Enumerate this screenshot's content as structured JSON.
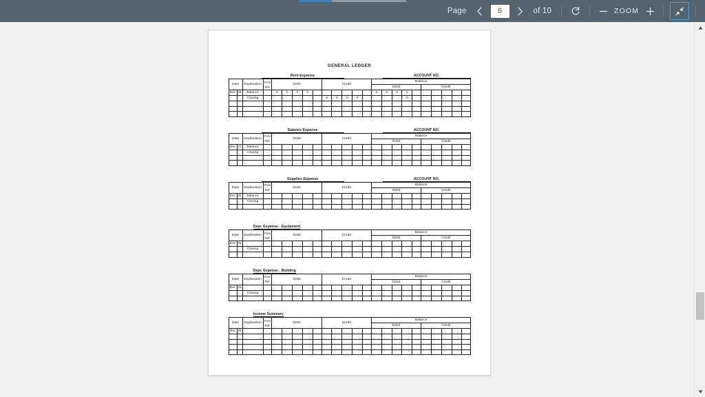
{
  "toolbar": {
    "page_label": "Page",
    "prev_icon": "chevron-left-icon",
    "next_icon": "chevron-right-icon",
    "page_value": "6",
    "of_label": "of 10",
    "rotate_icon": "rotate-icon",
    "zoom_out_icon": "minus-icon",
    "zoom_label": "ZOOM",
    "zoom_in_icon": "plus-icon",
    "fullscreen_exit_icon": "fullscreen-exit-icon",
    "bg_color": "#54646f",
    "accent_color": "#4a9fe0"
  },
  "progress": {
    "fill_color": "#3f7fb3",
    "track_color": "#8e9ba5"
  },
  "scrollbar": {
    "up_icon": "triangle-up-icon",
    "down_icon": "triangle-down-icon",
    "thumb_color": "#c1c1c1"
  },
  "document": {
    "title": "GENERAL LEDGER",
    "account_no_label": "ACCOUNT NO.",
    "headers": {
      "date": "Date",
      "explanation": "Explanation",
      "post": "Post",
      "ref": "Ref.",
      "debit": "Debit",
      "credit": "Credit",
      "balance": "Balance"
    },
    "ledgers": [
      {
        "name": "Rent Expense",
        "name_underline": true,
        "show_account_no": true,
        "title_align": "center",
        "rows": [
          {
            "month": "Dec",
            "day": "31",
            "explanation": "Balance",
            "debit": [
              "6",
              "0",
              "0",
              "0"
            ],
            "credit": [
              "",
              "",
              "",
              ""
            ],
            "bal_debit": [
              "6",
              "0",
              "0",
              "0"
            ],
            "bal_credit": [
              "",
              "",
              "",
              ""
            ]
          },
          {
            "month": "",
            "day": "",
            "explanation": "Closing",
            "debit": [
              "",
              "",
              "",
              ""
            ],
            "credit": [
              "6",
              "0",
              "0",
              "0"
            ],
            "bal_debit": [
              "",
              "",
              "",
              "0"
            ],
            "bal_credit": [
              "",
              "",
              "",
              ""
            ]
          },
          {
            "month": "",
            "day": "",
            "explanation": "",
            "debit": [
              "",
              "",
              "",
              ""
            ],
            "credit": [
              "",
              "",
              "",
              ""
            ],
            "bal_debit": [
              "",
              "",
              "",
              ""
            ],
            "bal_credit": [
              "",
              "",
              "",
              ""
            ]
          },
          {
            "month": "",
            "day": "",
            "explanation": "",
            "debit": [
              "",
              "",
              "",
              ""
            ],
            "credit": [
              "",
              "",
              "",
              ""
            ],
            "bal_debit": [
              "",
              "",
              "",
              ""
            ],
            "bal_credit": [
              "",
              "",
              "",
              ""
            ]
          },
          {
            "month": "",
            "day": "",
            "explanation": "",
            "debit": [
              "",
              "",
              "",
              ""
            ],
            "credit": [
              "",
              "",
              "",
              ""
            ],
            "bal_debit": [
              "",
              "",
              "",
              ""
            ],
            "bal_credit": [
              "",
              "",
              "",
              ""
            ]
          }
        ]
      },
      {
        "name": "Salaries Expense",
        "name_underline": true,
        "show_account_no": true,
        "title_align": "center",
        "rows": [
          {
            "month": "Dec",
            "day": "31",
            "explanation": "Balance",
            "debit": [
              "",
              "",
              "",
              ""
            ],
            "credit": [
              "",
              "",
              "",
              ""
            ],
            "bal_debit": [
              "",
              "",
              "",
              ""
            ],
            "bal_credit": [
              "",
              "",
              "",
              ""
            ]
          },
          {
            "month": "",
            "day": "",
            "explanation": "Closing",
            "debit": [
              "",
              "",
              "",
              ""
            ],
            "credit": [
              "",
              "",
              "",
              ""
            ],
            "bal_debit": [
              "",
              "",
              "",
              ""
            ],
            "bal_credit": [
              "",
              "",
              "",
              ""
            ]
          },
          {
            "month": "",
            "day": "",
            "explanation": "",
            "debit": [
              "",
              "",
              "",
              ""
            ],
            "credit": [
              "",
              "",
              "",
              ""
            ],
            "bal_debit": [
              "",
              "",
              "",
              ""
            ],
            "bal_credit": [
              "",
              "",
              "",
              ""
            ]
          },
          {
            "month": "",
            "day": "",
            "explanation": "",
            "debit": [
              "",
              "",
              "",
              ""
            ],
            "credit": [
              "",
              "",
              "",
              ""
            ],
            "bal_debit": [
              "",
              "",
              "",
              ""
            ],
            "bal_credit": [
              "",
              "",
              "",
              ""
            ]
          }
        ]
      },
      {
        "name": "Supplies Expense",
        "name_underline": true,
        "show_account_no": true,
        "title_align": "center",
        "rows": [
          {
            "month": "Dec",
            "day": "31",
            "explanation": "Balance",
            "debit": [
              "",
              "",
              "",
              ""
            ],
            "credit": [
              "",
              "",
              "",
              ""
            ],
            "bal_debit": [
              "",
              "",
              "",
              ""
            ],
            "bal_credit": [
              "",
              "",
              "",
              ""
            ]
          },
          {
            "month": "",
            "day": "",
            "explanation": "Closing",
            "debit": [
              "",
              "",
              "",
              ""
            ],
            "credit": [
              "",
              "",
              "",
              ""
            ],
            "bal_debit": [
              "",
              "",
              "",
              ""
            ],
            "bal_credit": [
              "",
              "",
              "",
              ""
            ]
          },
          {
            "month": "",
            "day": "",
            "explanation": "",
            "debit": [
              "",
              "",
              "",
              ""
            ],
            "credit": [
              "",
              "",
              "",
              ""
            ],
            "bal_debit": [
              "",
              "",
              "",
              ""
            ],
            "bal_credit": [
              "",
              "",
              "",
              ""
            ]
          }
        ]
      },
      {
        "name": "Depr. Expense - Equipment",
        "name_underline": true,
        "show_account_no": false,
        "title_align": "left",
        "rows": [
          {
            "month": "Dec",
            "day": "31",
            "explanation": "",
            "debit": [
              "",
              "",
              "",
              ""
            ],
            "credit": [
              "",
              "",
              "",
              ""
            ],
            "bal_debit": [
              "",
              "",
              "",
              ""
            ],
            "bal_credit": [
              "",
              "",
              "",
              ""
            ]
          },
          {
            "month": "",
            "day": "",
            "explanation": "Closing",
            "debit": [
              "",
              "",
              "",
              ""
            ],
            "credit": [
              "",
              "",
              "",
              ""
            ],
            "bal_debit": [
              "",
              "",
              "",
              ""
            ],
            "bal_credit": [
              "",
              "",
              "",
              ""
            ]
          },
          {
            "month": "",
            "day": "",
            "explanation": "",
            "debit": [
              "",
              "",
              "",
              ""
            ],
            "credit": [
              "",
              "",
              "",
              ""
            ],
            "bal_debit": [
              "",
              "",
              "",
              ""
            ],
            "bal_credit": [
              "",
              "",
              "",
              ""
            ]
          }
        ]
      },
      {
        "name": "Depr. Expense - Building",
        "name_underline": true,
        "show_account_no": false,
        "title_align": "left",
        "rows": [
          {
            "month": "Dec",
            "day": "31",
            "explanation": "",
            "debit": [
              "",
              "",
              "",
              ""
            ],
            "credit": [
              "",
              "",
              "",
              ""
            ],
            "bal_debit": [
              "",
              "",
              "",
              ""
            ],
            "bal_credit": [
              "",
              "",
              "",
              ""
            ]
          },
          {
            "month": "",
            "day": "",
            "explanation": "Closing",
            "debit": [
              "",
              "",
              "",
              ""
            ],
            "credit": [
              "",
              "",
              "",
              ""
            ],
            "bal_debit": [
              "",
              "",
              "",
              ""
            ],
            "bal_credit": [
              "",
              "",
              "",
              ""
            ]
          },
          {
            "month": "",
            "day": "",
            "explanation": "",
            "debit": [
              "",
              "",
              "",
              ""
            ],
            "credit": [
              "",
              "",
              "",
              ""
            ],
            "bal_debit": [
              "",
              "",
              "",
              ""
            ],
            "bal_credit": [
              "",
              "",
              "",
              ""
            ]
          }
        ]
      },
      {
        "name": "Income Summary",
        "name_underline": true,
        "show_account_no": false,
        "title_align": "left",
        "rows": [
          {
            "month": "Dec",
            "day": "31",
            "explanation": "",
            "debit": [
              "",
              "",
              "",
              ""
            ],
            "credit": [
              "",
              "",
              "",
              ""
            ],
            "bal_debit": [
              "",
              "",
              "",
              ""
            ],
            "bal_credit": [
              "",
              "",
              "",
              ""
            ]
          },
          {
            "month": "",
            "day": "",
            "explanation": "",
            "debit": [
              "",
              "",
              "",
              ""
            ],
            "credit": [
              "",
              "",
              "",
              ""
            ],
            "bal_debit": [
              "",
              "",
              "",
              ""
            ],
            "bal_credit": [
              "",
              "",
              "",
              ""
            ]
          },
          {
            "month": "",
            "day": "",
            "explanation": "",
            "debit": [
              "",
              "",
              "",
              ""
            ],
            "credit": [
              "",
              "",
              "",
              ""
            ],
            "bal_debit": [
              "",
              "",
              "",
              ""
            ],
            "bal_credit": [
              "",
              "",
              "",
              ""
            ]
          },
          {
            "month": "",
            "day": "",
            "explanation": "",
            "debit": [
              "",
              "",
              "",
              ""
            ],
            "credit": [
              "",
              "",
              "",
              ""
            ],
            "bal_debit": [
              "",
              "",
              "",
              ""
            ],
            "bal_credit": [
              "",
              "",
              "",
              ""
            ]
          },
          {
            "month": "",
            "day": "",
            "explanation": "",
            "debit": [
              "",
              "",
              "",
              ""
            ],
            "credit": [
              "",
              "",
              "",
              ""
            ],
            "bal_debit": [
              "",
              "",
              "",
              ""
            ],
            "bal_credit": [
              "",
              "",
              "",
              ""
            ]
          }
        ]
      }
    ]
  }
}
